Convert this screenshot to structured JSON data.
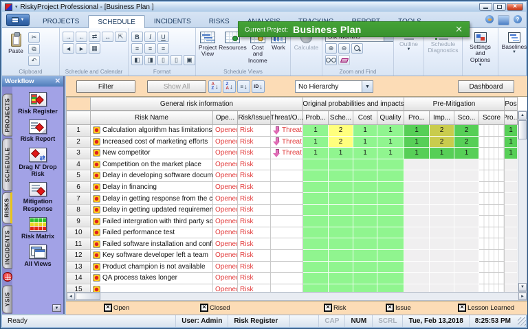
{
  "colors": {
    "banner_green": "#44a336",
    "toolbar_peach": "#fcdcb6",
    "sidebar_purple": "#a2a2e6",
    "status_red": "#e23b3b"
  },
  "window": {
    "title": "RiskyProject Professional - [Business Plan ]"
  },
  "menu_tabs": [
    {
      "label": "PROJECTS"
    },
    {
      "label": "SCHEDULE",
      "active": true
    },
    {
      "label": "INCIDENTS"
    },
    {
      "label": "RISKS"
    },
    {
      "label": "ANALYSIS"
    },
    {
      "label": "TRACKING"
    },
    {
      "label": "REPORT"
    },
    {
      "label": "TOOLS"
    }
  ],
  "banner": {
    "prefix": "Current Project:",
    "project": "Business Plan"
  },
  "ribbon": {
    "clipboard": {
      "paste": "Paste",
      "label": "Clipboard"
    },
    "schedule_calendar": {
      "label": "Schedule and Calendar"
    },
    "format": {
      "label": "Format",
      "bold": "B",
      "italic": "I",
      "underline": "U"
    },
    "schedule_views": {
      "label": "Schedule Views",
      "buttons": [
        "Project View",
        "Resources",
        "Cost and Income",
        "Work"
      ]
    },
    "calculate": "Calculate",
    "zoom_find": {
      "label": "Zoom and Find",
      "range": "Six Months"
    },
    "outline": "Outline",
    "schedule_diagnostics": "Schedule Diagnostics",
    "settings_options": "Settings and Options",
    "baselines": "Baselines"
  },
  "sidebar": {
    "title": "Workflow",
    "vtabs": [
      {
        "label": "PROJECTS"
      },
      {
        "label": "SCHEDULE"
      },
      {
        "label": "RISKS",
        "active": true
      },
      {
        "label": "INCIDENTS"
      },
      {
        "icon": "risk-ball"
      },
      {
        "label": "YSIS"
      }
    ],
    "items": [
      {
        "label": "Risk Register",
        "icon": "risk-register"
      },
      {
        "label": "Risk Report",
        "icon": "risk-report"
      },
      {
        "label": "Drag N' Drop Risk",
        "icon": "drag-drop"
      },
      {
        "label": "Mitigation Response",
        "icon": "mitigation"
      },
      {
        "label": "Risk Matrix",
        "icon": "risk-matrix"
      },
      {
        "label": "All Views",
        "icon": "all-views"
      }
    ]
  },
  "toolbar": {
    "filter": "Filter",
    "show_all": "Show All",
    "hierarchy": "No Hierarchy",
    "dashboard": "Dashboard"
  },
  "table": {
    "groups": [
      "General risk information",
      "Original probabilities and impacts",
      "Pre-Mitigation",
      "Pos"
    ],
    "columns": [
      "Risk Name",
      "Ope...",
      "Risk/Issue",
      "Threat/O...",
      "Prob...",
      "Sche...",
      "Cost",
      "Quality",
      "Pro...",
      "Imp...",
      "Sco...",
      "Score",
      "Pro..."
    ],
    "cell_colors": {
      "g": "#90f58f",
      "y": "#ffff7d",
      "G": "#57cf57",
      "o": "#c9cc4d",
      "x": "#f0eff0"
    },
    "rows": [
      {
        "num": "1",
        "name": "Calculation algorithm has limitations",
        "status": "Opened",
        "type": "Risk",
        "threat": "Threat",
        "orig": [
          [
            "1",
            "g"
          ],
          [
            "2",
            "y"
          ],
          [
            "1",
            "g"
          ],
          [
            "1",
            "g"
          ]
        ],
        "pre": [
          [
            "1",
            "G"
          ],
          [
            "2",
            "o"
          ],
          [
            "2",
            "G"
          ]
        ],
        "post": [
          "1",
          "G"
        ]
      },
      {
        "num": "2",
        "name": "Increased cost of marketing efforts",
        "status": "Opened",
        "type": "Risk",
        "threat": "Threat",
        "orig": [
          [
            "1",
            "g"
          ],
          [
            "2",
            "y"
          ],
          [
            "1",
            "g"
          ],
          [
            "1",
            "g"
          ]
        ],
        "pre": [
          [
            "1",
            "G"
          ],
          [
            "2",
            "o"
          ],
          [
            "2",
            "G"
          ]
        ],
        "post": [
          "1",
          "G"
        ]
      },
      {
        "num": "3",
        "name": "New competitor",
        "status": "Opened",
        "type": "Risk",
        "threat": "Threat",
        "orig": [
          [
            "1",
            "g"
          ],
          [
            "1",
            "g"
          ],
          [
            "1",
            "g"
          ],
          [
            "1",
            "g"
          ]
        ],
        "pre": [
          [
            "1",
            "G"
          ],
          [
            "1",
            "G"
          ],
          [
            "1",
            "G"
          ]
        ],
        "post": [
          "1",
          "G"
        ]
      },
      {
        "num": "4",
        "name": "Competition on the market place",
        "status": "Opened",
        "type": "Risk",
        "threat": "",
        "orig": [
          [
            "",
            "g"
          ],
          [
            "",
            "g"
          ],
          [
            "",
            "g"
          ],
          [
            "",
            "g"
          ]
        ],
        "pre": [
          [
            "",
            "x"
          ],
          [
            "",
            "x"
          ],
          [
            "",
            "x"
          ]
        ],
        "post": [
          "",
          "x"
        ]
      },
      {
        "num": "5",
        "name": "Delay in developing software documentation",
        "status": "Opened",
        "type": "Risk",
        "threat": "",
        "orig": [
          [
            "",
            "g"
          ],
          [
            "",
            "g"
          ],
          [
            "",
            "g"
          ],
          [
            "",
            "g"
          ]
        ],
        "pre": [
          [
            "",
            "x"
          ],
          [
            "",
            "x"
          ],
          [
            "",
            "x"
          ]
        ],
        "post": [
          "",
          "x"
        ]
      },
      {
        "num": "6",
        "name": "Delay in financing",
        "status": "Opened",
        "type": "Risk",
        "threat": "",
        "orig": [
          [
            "",
            "g"
          ],
          [
            "",
            "g"
          ],
          [
            "",
            "g"
          ],
          [
            "",
            "g"
          ]
        ],
        "pre": [
          [
            "",
            "x"
          ],
          [
            "",
            "x"
          ],
          [
            "",
            "x"
          ]
        ],
        "post": [
          "",
          "x"
        ]
      },
      {
        "num": "7",
        "name": "Delay in getting response from the client",
        "status": "Opened",
        "type": "Risk",
        "threat": "",
        "orig": [
          [
            "",
            "g"
          ],
          [
            "",
            "g"
          ],
          [
            "",
            "g"
          ],
          [
            "",
            "g"
          ]
        ],
        "pre": [
          [
            "",
            "x"
          ],
          [
            "",
            "x"
          ],
          [
            "",
            "x"
          ]
        ],
        "post": [
          "",
          "x"
        ]
      },
      {
        "num": "8",
        "name": "Delay in getting updated requirements",
        "status": "Opened",
        "type": "Risk",
        "threat": "",
        "orig": [
          [
            "",
            "g"
          ],
          [
            "",
            "g"
          ],
          [
            "",
            "g"
          ],
          [
            "",
            "g"
          ]
        ],
        "pre": [
          [
            "",
            "x"
          ],
          [
            "",
            "x"
          ],
          [
            "",
            "x"
          ]
        ],
        "post": [
          "",
          "x"
        ]
      },
      {
        "num": "9",
        "name": "Failed intergration with third party software",
        "status": "Opened",
        "type": "Risk",
        "threat": "",
        "orig": [
          [
            "",
            "g"
          ],
          [
            "",
            "g"
          ],
          [
            "",
            "g"
          ],
          [
            "",
            "g"
          ]
        ],
        "pre": [
          [
            "",
            "x"
          ],
          [
            "",
            "x"
          ],
          [
            "",
            "x"
          ]
        ],
        "post": [
          "",
          "x"
        ]
      },
      {
        "num": "10",
        "name": "Failed performance test",
        "status": "Opened",
        "type": "Risk",
        "threat": "",
        "orig": [
          [
            "",
            "g"
          ],
          [
            "",
            "g"
          ],
          [
            "",
            "g"
          ],
          [
            "",
            "g"
          ]
        ],
        "pre": [
          [
            "",
            "x"
          ],
          [
            "",
            "x"
          ],
          [
            "",
            "x"
          ]
        ],
        "post": [
          "",
          "x"
        ]
      },
      {
        "num": "11",
        "name": "Failed software installation and configuration",
        "status": "Opened",
        "type": "Risk",
        "threat": "",
        "orig": [
          [
            "",
            "g"
          ],
          [
            "",
            "g"
          ],
          [
            "",
            "g"
          ],
          [
            "",
            "g"
          ]
        ],
        "pre": [
          [
            "",
            "x"
          ],
          [
            "",
            "x"
          ],
          [
            "",
            "x"
          ]
        ],
        "post": [
          "",
          "x"
        ]
      },
      {
        "num": "12",
        "name": "Key software developer left a team",
        "status": "Opened",
        "type": "Risk",
        "threat": "",
        "orig": [
          [
            "",
            "g"
          ],
          [
            "",
            "g"
          ],
          [
            "",
            "g"
          ],
          [
            "",
            "g"
          ]
        ],
        "pre": [
          [
            "",
            "x"
          ],
          [
            "",
            "x"
          ],
          [
            "",
            "x"
          ]
        ],
        "post": [
          "",
          "x"
        ]
      },
      {
        "num": "13",
        "name": "Product champion is not available",
        "status": "Opened",
        "type": "Risk",
        "threat": "",
        "orig": [
          [
            "",
            "g"
          ],
          [
            "",
            "g"
          ],
          [
            "",
            "g"
          ],
          [
            "",
            "g"
          ]
        ],
        "pre": [
          [
            "",
            "x"
          ],
          [
            "",
            "x"
          ],
          [
            "",
            "x"
          ]
        ],
        "post": [
          "",
          "x"
        ]
      },
      {
        "num": "14",
        "name": "QA process takes longer",
        "status": "Opened",
        "type": "Risk",
        "threat": "",
        "orig": [
          [
            "",
            "g"
          ],
          [
            "",
            "g"
          ],
          [
            "",
            "g"
          ],
          [
            "",
            "g"
          ]
        ],
        "pre": [
          [
            "",
            "x"
          ],
          [
            "",
            "x"
          ],
          [
            "",
            "x"
          ]
        ],
        "post": [
          "",
          "x"
        ]
      },
      {
        "num": "15",
        "name": "",
        "status": "Opened",
        "type": "Risk",
        "threat": "",
        "orig": [
          [
            "",
            "g"
          ],
          [
            "",
            "g"
          ],
          [
            "",
            "g"
          ],
          [
            "",
            "g"
          ]
        ],
        "pre": [
          [
            "",
            "x"
          ],
          [
            "",
            "x"
          ],
          [
            "",
            "x"
          ]
        ],
        "post": [
          "",
          "x"
        ]
      }
    ]
  },
  "legend": [
    {
      "label": "Open"
    },
    {
      "label": "Closed"
    },
    {
      "label": "Risk"
    },
    {
      "label": "Issue"
    },
    {
      "label": "Lesson Learned"
    }
  ],
  "statusbar": {
    "ready": "Ready",
    "user": "User: Admin",
    "view": "Risk Register",
    "cap": "CAP",
    "num": "NUM",
    "scrl": "SCRL",
    "date": "Tue, Feb 13,2018",
    "time": "8:25:53 PM"
  }
}
